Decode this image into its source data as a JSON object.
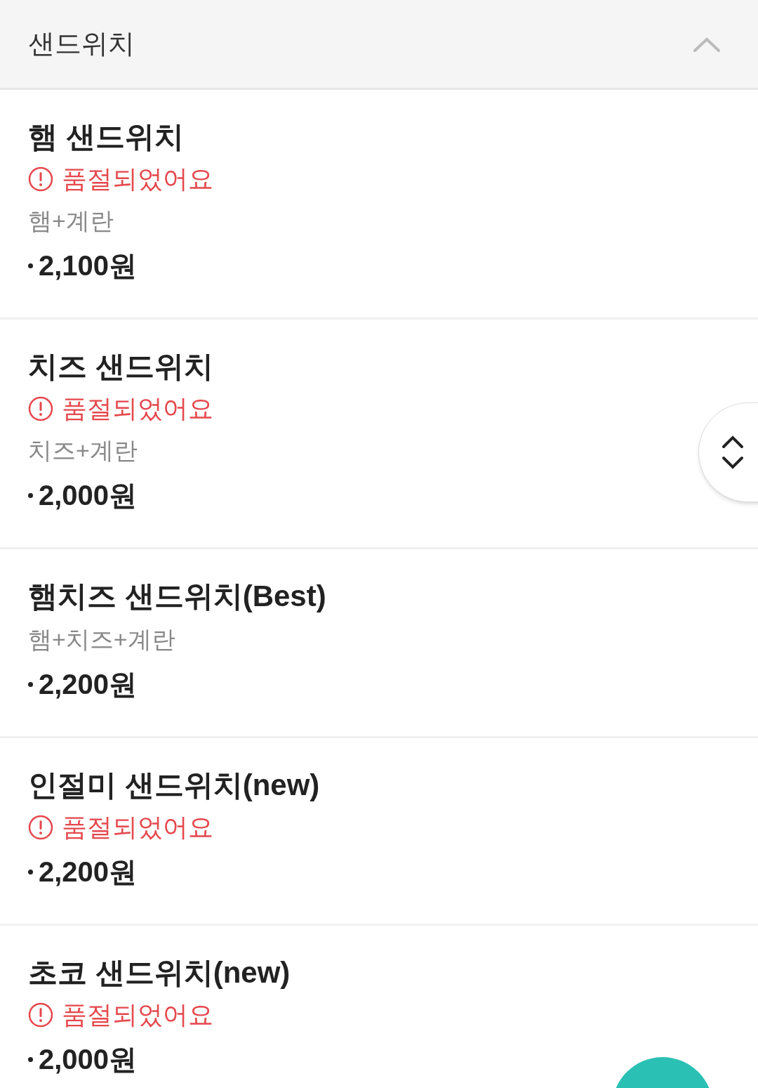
{
  "category": {
    "title": "샌드위치",
    "expanded": true
  },
  "items": [
    {
      "name": "햄 샌드위치",
      "notice": "품절되었어요",
      "description": "햄+계란",
      "price": "2,100원"
    },
    {
      "name": "치즈 샌드위치",
      "notice": "품절되었어요",
      "description": "치즈+계란",
      "price": "2,000원"
    },
    {
      "name": "햄치즈 샌드위치(Best)",
      "description": "햄+치즈+계란",
      "price": "2,200원"
    },
    {
      "name": "인절미 샌드위치(new)",
      "notice": "품절되었어요",
      "price": "2,200원"
    },
    {
      "name": "초코 샌드위치(new)",
      "notice": "품절되었어요",
      "price": "2,000원"
    }
  ]
}
